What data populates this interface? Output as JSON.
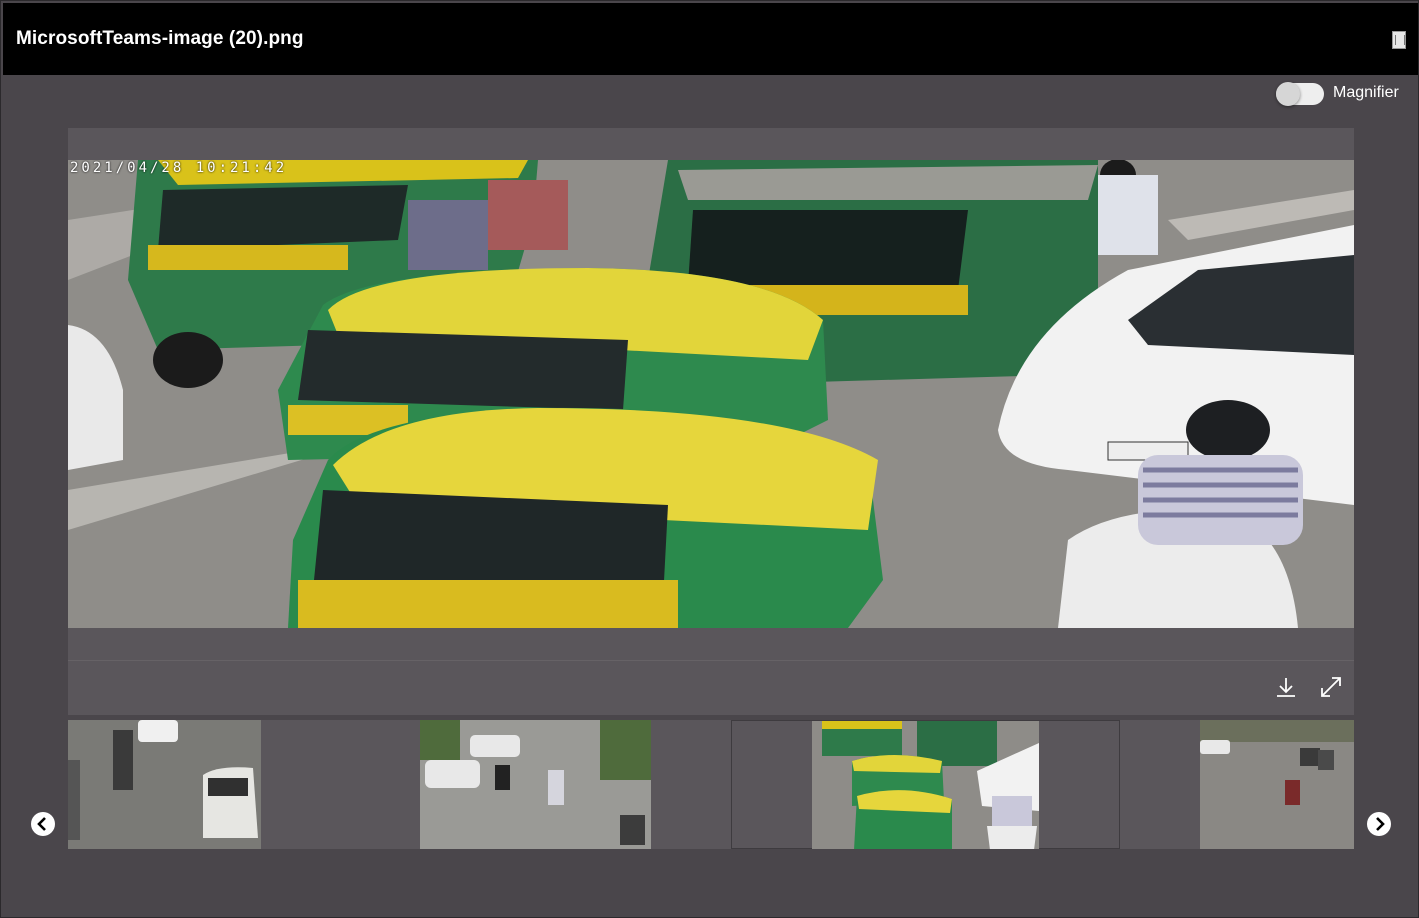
{
  "window": {
    "title": "MicrosoftTeams-image (20).png",
    "close_icon": "close-icon"
  },
  "magnifier": {
    "label": "Magnifier",
    "enabled": false
  },
  "viewer": {
    "timestamp": "2021/04/28 10:21:42",
    "download_icon": "download-icon",
    "fullscreen_icon": "expand-icon"
  },
  "thumbnails": {
    "count": 4,
    "active_index": 2
  },
  "navigation": {
    "prev_icon": "chevron-left-circle-icon",
    "next_icon": "chevron-right-circle-icon"
  },
  "colors": {
    "titlebar": "#000000",
    "background": "#4a464b",
    "panel": "#5a565b",
    "text": "#ffffff"
  }
}
